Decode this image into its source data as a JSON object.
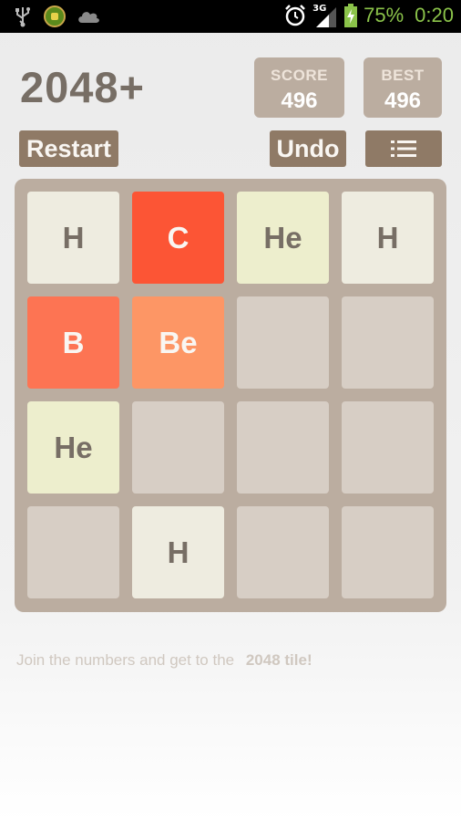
{
  "status_bar": {
    "network": "3G",
    "battery_percent": "75%",
    "time": "0:20",
    "icons": [
      "usb-icon",
      "game-icon",
      "cloud-icon",
      "alarm-icon",
      "signal-icon",
      "battery-charging-icon"
    ]
  },
  "header": {
    "title": "2048+",
    "score_label": "SCORE",
    "score_value": "496",
    "best_label": "BEST",
    "best_value": "496"
  },
  "toolbar": {
    "restart_label": "Restart",
    "undo_label": "Undo",
    "menu_icon": "list-menu-icon"
  },
  "board": {
    "rows": [
      [
        "H",
        "C",
        "He",
        "H"
      ],
      [
        "B",
        "Be",
        "",
        ""
      ],
      [
        "He",
        "",
        "",
        ""
      ],
      [
        "",
        "H",
        "",
        ""
      ]
    ]
  },
  "tile_styles": {
    "H": {
      "bg": "#eeece0",
      "fg": "#776e65"
    },
    "He": {
      "bg": "#edeecd",
      "fg": "#776e65"
    },
    "Be": {
      "bg": "#fd9665",
      "fg": "#f9f6f2"
    },
    "B": {
      "bg": "#fd7453",
      "fg": "#f9f6f2"
    },
    "C": {
      "bg": "#fc5535",
      "fg": "#f9f6f2"
    },
    "empty": {
      "bg": "#d7cec5",
      "fg": "#776e65"
    }
  },
  "footer": {
    "text": "Join the numbers and get to the",
    "highlight": "2048 tile!"
  }
}
